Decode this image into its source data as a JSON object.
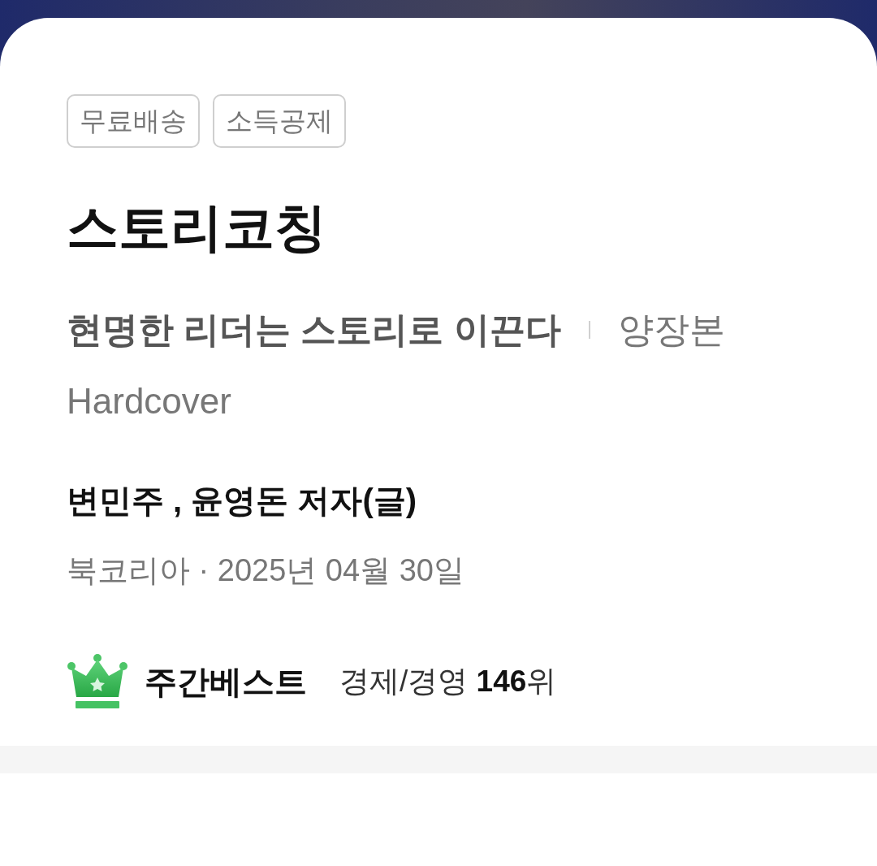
{
  "badges": [
    "무료배송",
    "소득공제"
  ],
  "title": "스토리코칭",
  "subtitle": "현명한 리더는 스토리로 이끈다",
  "edition": [
    "양장본",
    "Hardcover"
  ],
  "authors": "변민주 , 윤영돈 저자(글)",
  "publisher_line": "북코리아 · 2025년 04월 30일",
  "best": {
    "label": "주간베스트",
    "ranking": "경제/경영 **146**위"
  }
}
